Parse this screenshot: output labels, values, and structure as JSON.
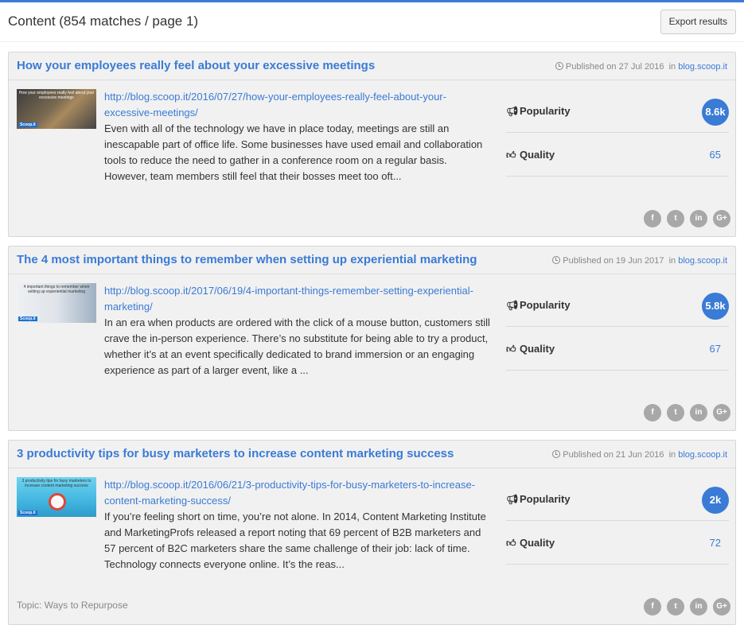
{
  "header": {
    "title": "Content (854 matches / page 1)",
    "export_label": "Export results"
  },
  "labels": {
    "published_prefix": "Published on",
    "in": "in",
    "popularity": "Popularity",
    "quality": "Quality"
  },
  "social_icons": [
    "facebook-icon",
    "twitter-icon",
    "linkedin-icon",
    "google-plus-icon"
  ],
  "social_glyphs": [
    "f",
    "t",
    "in",
    "G+"
  ],
  "accent_color": "#3a7bd5",
  "results": [
    {
      "title": "How your employees really feel about your excessive meetings",
      "date": "27 Jul 2016",
      "source": "blog.scoop.it",
      "url": "http://blog.scoop.it/2016/07/27/how-your-employees-really-feel-about-your-excessive-meetings/",
      "excerpt": "Even with all of the technology we have in place today, meetings are still an inescapable part of office life. Some businesses have used email and collaboration tools to reduce the need to gather in a conference room on a regular basis. However, team members still feel that their bosses meet too oft...",
      "popularity": "8.6k",
      "quality": "65",
      "thumb_caption": "How your employees really feel about your excessive meetings",
      "thumb_brand": "Scoop.it"
    },
    {
      "title": "The 4 most important things to remember when setting up experiential marketing",
      "date": "19 Jun 2017",
      "source": "blog.scoop.it",
      "url": "http://blog.scoop.it/2017/06/19/4-important-things-remember-setting-experiential-marketing/",
      "excerpt": "In an era when products are ordered with the click of a mouse button, customers still crave the in-person experience. There’s no substitute for being able to try a product, whether it’s at an event specifically dedicated to brand immersion or an engaging experience as part of a larger event, like a ...",
      "popularity": "5.8k",
      "quality": "67",
      "thumb_caption": "4 important things to remember when setting up experiential marketing",
      "thumb_brand": "Scoop.it"
    },
    {
      "title": "3 productivity tips for busy marketers to increase content marketing success",
      "date": "21 Jun 2016",
      "source": "blog.scoop.it",
      "url": "http://blog.scoop.it/2016/06/21/3-productivity-tips-for-busy-marketers-to-increase-content-marketing-success/",
      "excerpt": "If you’re feeling short on time, you’re not alone. In 2014, Content Marketing Institute and MarketingProfs released a report noting that 69 percent of B2B marketers and 57 percent of B2C marketers share the same challenge of their job: lack of time. Technology connects everyone online. It’s the reas...",
      "popularity": "2k",
      "quality": "72",
      "thumb_caption": "3 productivity tips for busy marketers to increase content marketing success",
      "thumb_brand": "Scoop.it",
      "topic": "Topic: Ways to Repurpose"
    }
  ]
}
